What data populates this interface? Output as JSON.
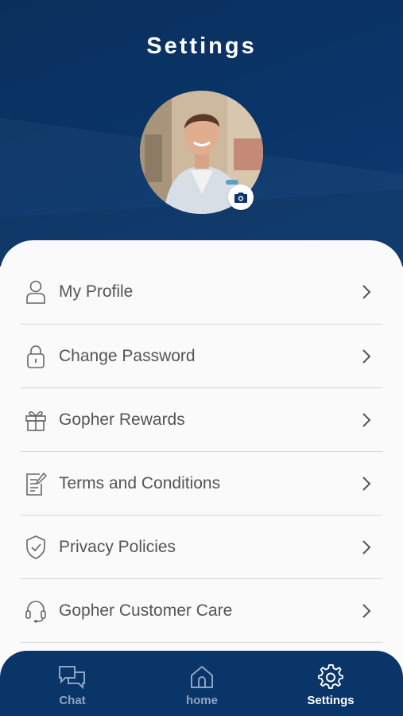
{
  "header": {
    "title": "Settings"
  },
  "profile": {
    "avatar_icon": "profile-photo",
    "camera_icon": "camera-icon"
  },
  "menu": {
    "items": [
      {
        "label": "My Profile",
        "icon": "user-icon"
      },
      {
        "label": "Change Password",
        "icon": "lock-icon"
      },
      {
        "label": "Gopher Rewards",
        "icon": "gift-icon"
      },
      {
        "label": "Terms and Conditions",
        "icon": "document-edit-icon"
      },
      {
        "label": "Privacy Policies",
        "icon": "shield-check-icon"
      },
      {
        "label": "Gopher Customer Care",
        "icon": "headset-icon"
      }
    ]
  },
  "bottom_nav": {
    "items": [
      {
        "label": "Chat",
        "icon": "chat-icon",
        "active": false
      },
      {
        "label": "home",
        "icon": "home-icon",
        "active": false
      },
      {
        "label": "Settings",
        "icon": "gear-icon",
        "active": true
      }
    ]
  },
  "colors": {
    "primary": "#0a3569",
    "text": "#555555",
    "inactive_nav": "#8fa4c3",
    "divider": "#d8d8d8"
  }
}
